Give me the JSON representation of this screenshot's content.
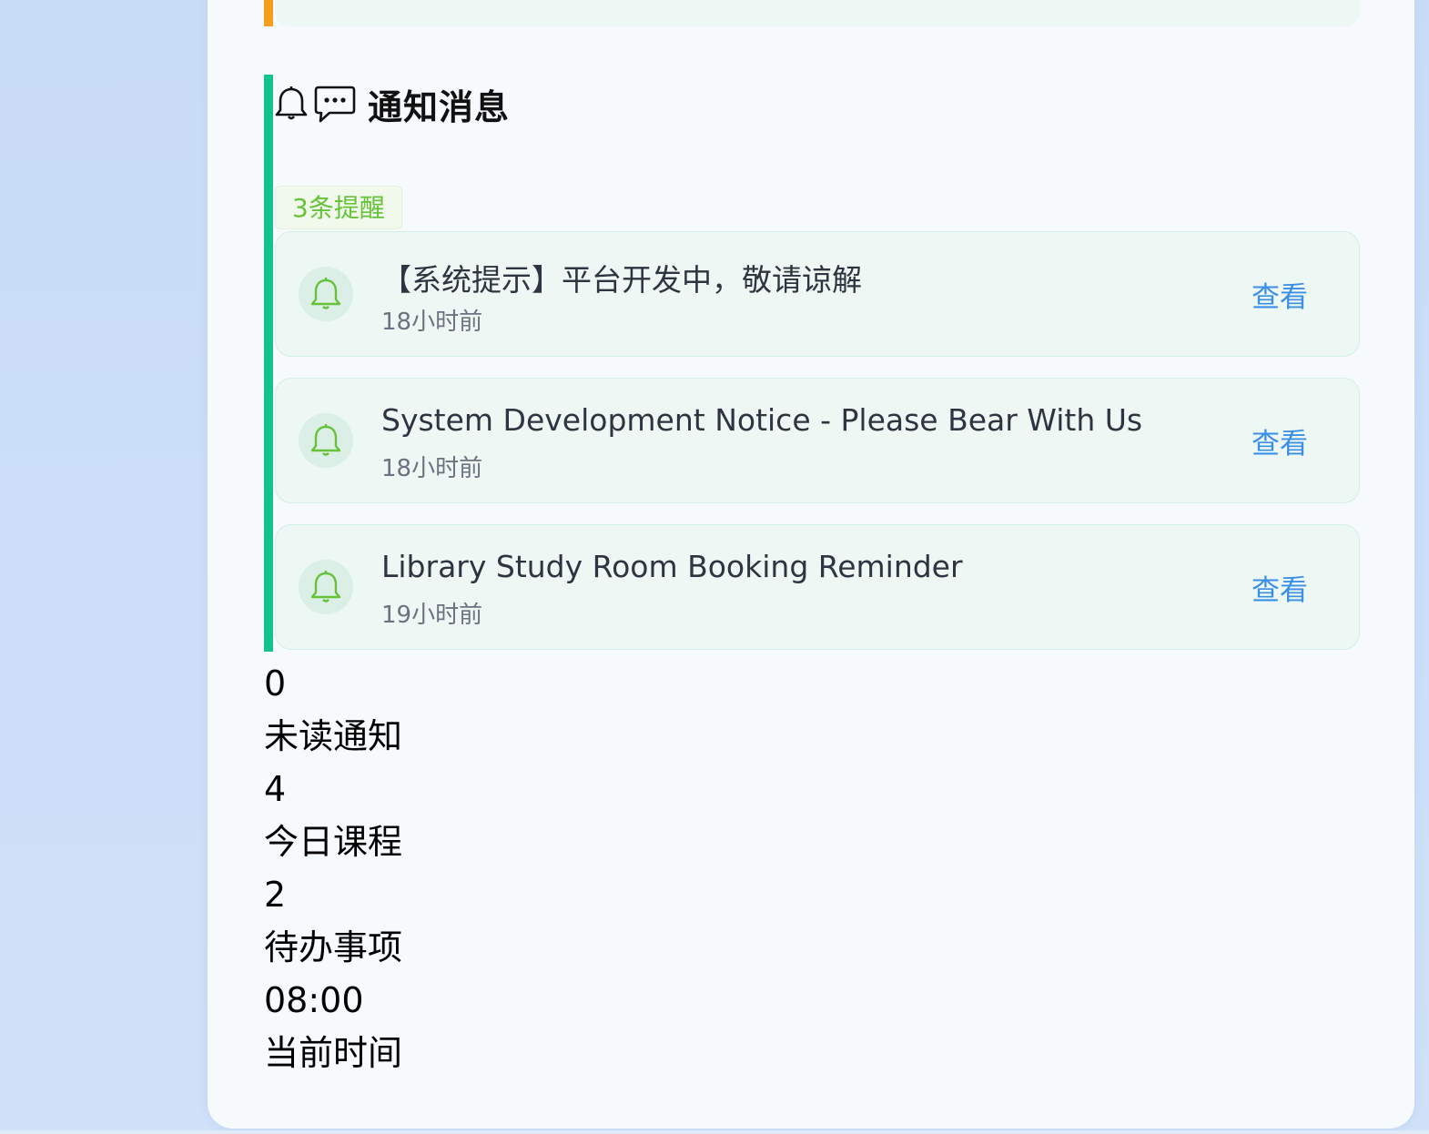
{
  "notifications": {
    "title": "通知消息",
    "badge": "3条提醒",
    "items": [
      {
        "title": "【系统提示】平台开发中，敬请谅解",
        "time": "18小时前",
        "action": "查看"
      },
      {
        "title": "System Development Notice - Please Bear With Us",
        "time": "18小时前",
        "action": "查看"
      },
      {
        "title": "Library Study Room Booking Reminder",
        "time": "19小时前",
        "action": "查看"
      }
    ]
  },
  "stats": [
    {
      "value": "0",
      "label": "未读通知"
    },
    {
      "value": "4",
      "label": "今日课程"
    },
    {
      "value": "2",
      "label": "待办事项"
    },
    {
      "value": "08:00",
      "label": "当前时间"
    }
  ],
  "colors": {
    "accent_green": "#13c38b",
    "accent_orange": "#f59e1b",
    "link_blue": "#3b8fe6",
    "badge_green": "#67c23a",
    "bell_green": "#67c23a"
  },
  "icons": {
    "header": [
      "bell-icon",
      "chat-bubble-icon"
    ],
    "item": "bell-icon"
  }
}
